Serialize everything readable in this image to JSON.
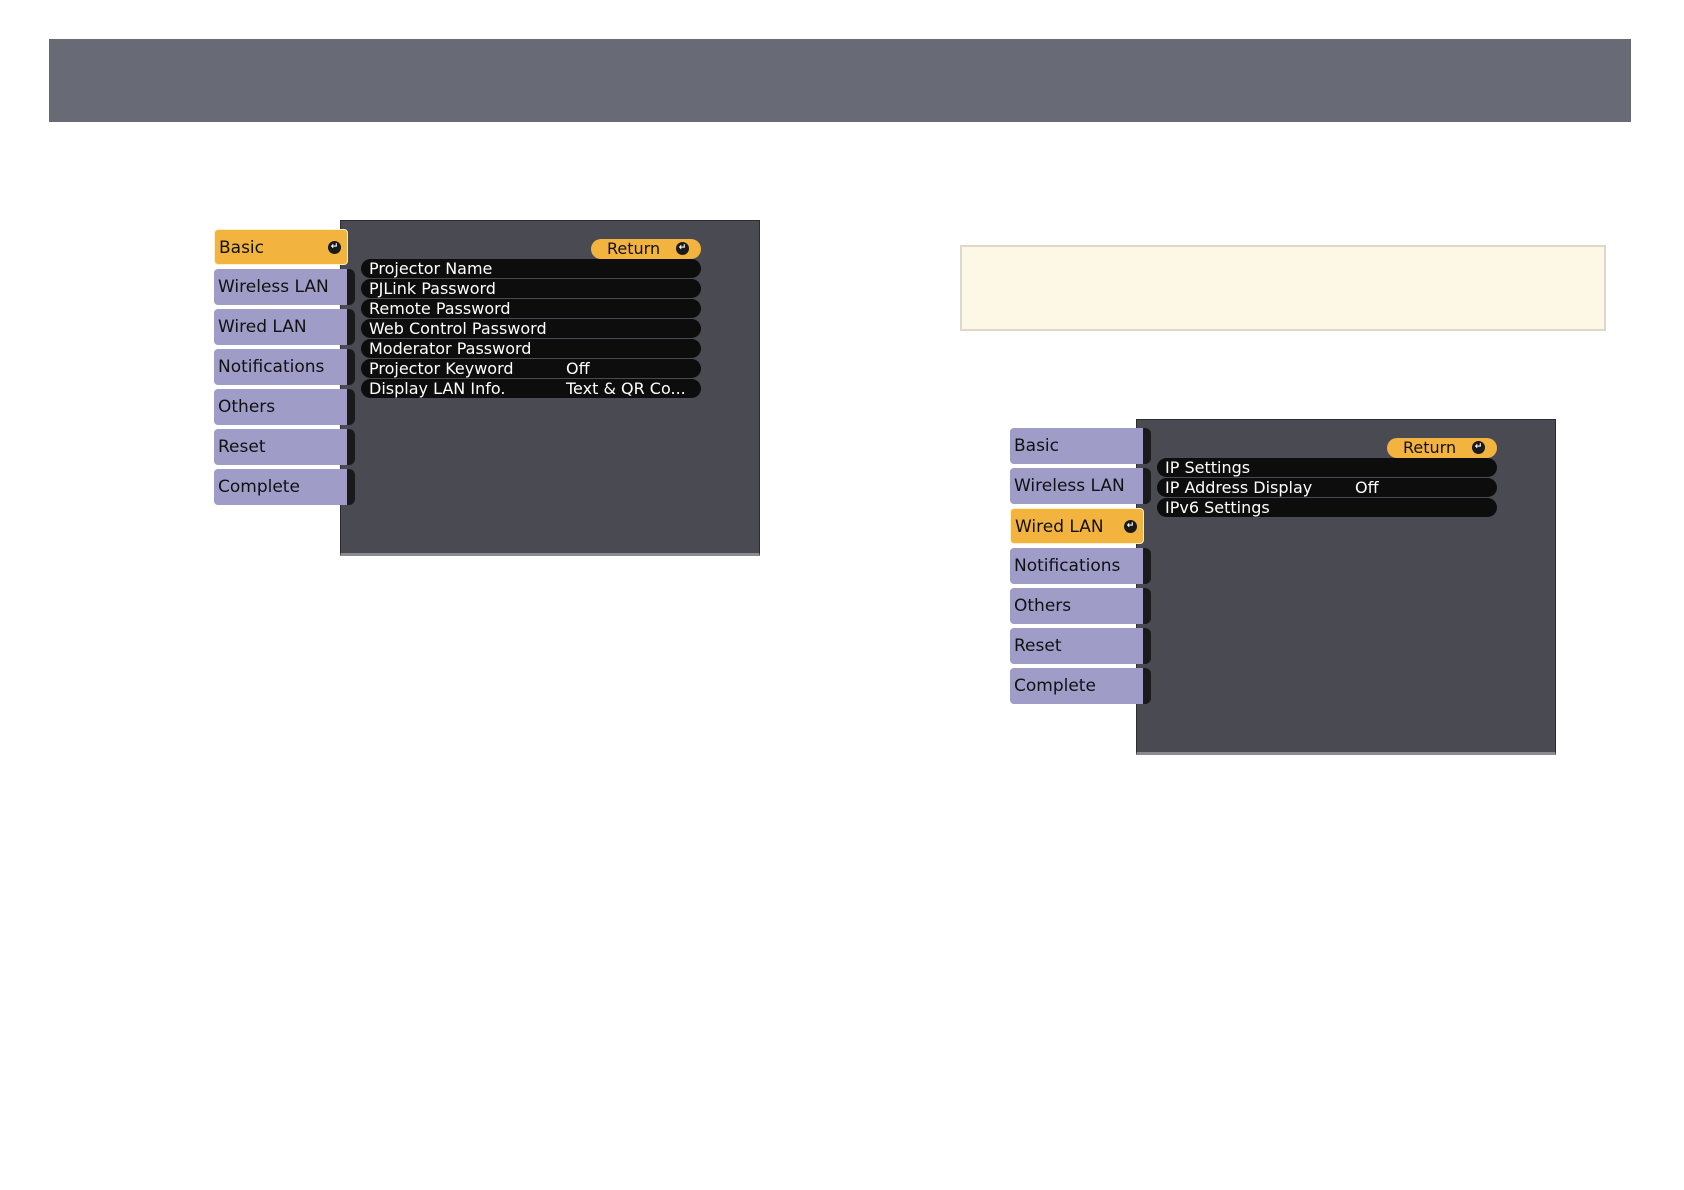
{
  "left_menu": {
    "tabs": [
      {
        "label": "Basic",
        "active": true
      },
      {
        "label": "Wireless LAN",
        "active": false
      },
      {
        "label": "Wired LAN",
        "active": false
      },
      {
        "label": "Notifications",
        "active": false
      },
      {
        "label": "Others",
        "active": false
      },
      {
        "label": "Reset",
        "active": false
      },
      {
        "label": "Complete",
        "active": false
      }
    ],
    "return_label": "Return",
    "rows": [
      {
        "label": "Projector Name",
        "value": ""
      },
      {
        "label": "PJLink Password",
        "value": ""
      },
      {
        "label": "Remote Password",
        "value": ""
      },
      {
        "label": "Web Control Password",
        "value": ""
      },
      {
        "label": "Moderator Password",
        "value": ""
      },
      {
        "label": "Projector Keyword",
        "value": "Off"
      },
      {
        "label": "Display LAN Info.",
        "value": "Text & QR Co..."
      }
    ]
  },
  "right_menu": {
    "tabs": [
      {
        "label": "Basic",
        "active": false
      },
      {
        "label": "Wireless LAN",
        "active": false
      },
      {
        "label": "Wired LAN",
        "active": true
      },
      {
        "label": "Notifications",
        "active": false
      },
      {
        "label": "Others",
        "active": false
      },
      {
        "label": "Reset",
        "active": false
      },
      {
        "label": "Complete",
        "active": false
      }
    ],
    "return_label": "Return",
    "rows": [
      {
        "label": "IP Settings",
        "value": ""
      },
      {
        "label": "IP Address Display",
        "value": "Off"
      },
      {
        "label": "IPv6 Settings",
        "value": ""
      }
    ]
  },
  "colors": {
    "header": "#686b75",
    "tab": "#a09cc8",
    "tab_active": "#f3b43f",
    "panel": "#4a4a52",
    "row": "#0d0d0d",
    "note": "#fdf8e6"
  },
  "icons": {
    "enter": "enter-icon"
  }
}
